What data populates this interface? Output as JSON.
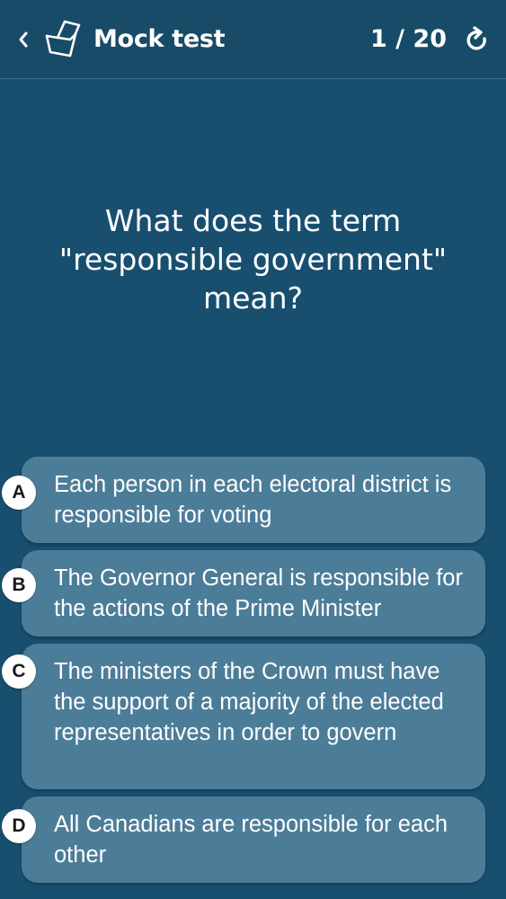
{
  "header": {
    "title": "Mock test",
    "counter": "1 / 20",
    "icons": {
      "back": "chevron-left-icon",
      "test": "test-paper-icon",
      "restart": "restart-icon"
    }
  },
  "question": {
    "text": "What does the term \"responsible government\" mean?"
  },
  "answers": [
    {
      "letter": "A",
      "text": "Each person in each electoral district is responsible for voting"
    },
    {
      "letter": "B",
      "text": "The Governor General is responsible for the actions of the Prime Minister"
    },
    {
      "letter": "C",
      "text": "The ministers of the Crown must have the support of a majority of the elected representatives in order to govern"
    },
    {
      "letter": "D",
      "text": "All Canadians are responsible for each other"
    }
  ],
  "colors": {
    "background": "#184f6f",
    "card": "#4c7d98",
    "badge": "#ffffff"
  }
}
